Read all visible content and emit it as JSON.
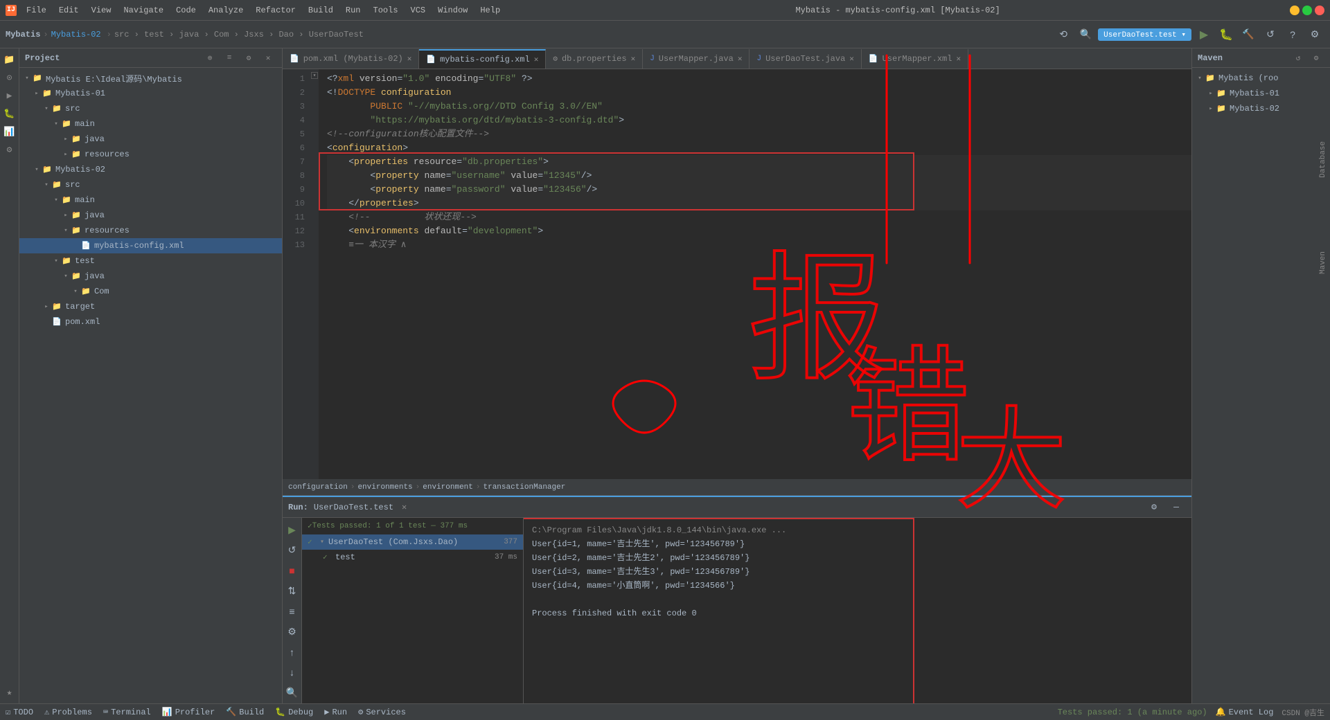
{
  "titlebar": {
    "title": "Mybatis - mybatis-config.xml [Mybatis-02]",
    "logo": "IJ",
    "menus": [
      "File",
      "Edit",
      "View",
      "Navigate",
      "Code",
      "Analyze",
      "Refactor",
      "Build",
      "Run",
      "Tools",
      "VCS",
      "Window",
      "Help"
    ]
  },
  "breadcrumb": {
    "items": [
      "Mybatis",
      "Mybatis-02",
      "src",
      "test",
      "java",
      "Com",
      "Jsxs",
      "Dao",
      "UserDaoTest"
    ]
  },
  "tabs": [
    {
      "label": "pom.xml (Mybatis-02)",
      "active": false,
      "icon": "pom"
    },
    {
      "label": "mybatis-config.xml",
      "active": true,
      "icon": "xml"
    },
    {
      "label": "db.properties",
      "active": false,
      "icon": "props"
    },
    {
      "label": "UserMapper.java",
      "active": false,
      "icon": "java"
    },
    {
      "label": "UserDaoTest.java",
      "active": false,
      "icon": "java"
    },
    {
      "label": "UserMapper.xml",
      "active": false,
      "icon": "xml"
    }
  ],
  "code": {
    "lines": [
      {
        "num": 1,
        "text": "<?xml version=\"1.0\" encoding=\"UTF8\" ?>"
      },
      {
        "num": 2,
        "text": "<!DOCTYPE configuration"
      },
      {
        "num": 3,
        "text": "        PUBLIC \"-//mybatis.org//DTD Config 3.0//EN\""
      },
      {
        "num": 4,
        "text": "        \"https://mybatis.org/dtd/mybatis-3-config.dtd\">"
      },
      {
        "num": 5,
        "text": "<!--configuration核心配置文件-->"
      },
      {
        "num": 6,
        "text": "<configuration>"
      },
      {
        "num": 7,
        "text": "    <properties resource=\"db.properties\">"
      },
      {
        "num": 8,
        "text": "        <property name=\"username\" value=\"12345\"/>"
      },
      {
        "num": 9,
        "text": "        <property name=\"password\" value=\"123456\"/>"
      },
      {
        "num": 10,
        "text": "    </properties>"
      },
      {
        "num": 11,
        "text": "    <!--          状状还现-->"
      },
      {
        "num": 12,
        "text": "    <environments default=\"development\">"
      },
      {
        "num": 13,
        "text": "    <)"
      }
    ]
  },
  "nav_breadcrumb": {
    "items": [
      "configuration",
      "environments",
      "environment",
      "transactionManager"
    ]
  },
  "project": {
    "title": "Project",
    "tree": [
      {
        "id": "mybatis-root",
        "label": "Mybatis E:\\Ideal源码\\Mybatis",
        "level": 0,
        "expanded": true,
        "icon": "folder"
      },
      {
        "id": "mybatis-01",
        "label": "Mybatis-01",
        "level": 1,
        "expanded": true,
        "icon": "folder"
      },
      {
        "id": "src-01",
        "label": "src",
        "level": 2,
        "expanded": true,
        "icon": "folder"
      },
      {
        "id": "main-01",
        "label": "main",
        "level": 3,
        "expanded": true,
        "icon": "folder"
      },
      {
        "id": "java-01",
        "label": "java",
        "level": 4,
        "expanded": false,
        "icon": "folder"
      },
      {
        "id": "resources-01",
        "label": "resources",
        "level": 4,
        "expanded": false,
        "icon": "folder"
      },
      {
        "id": "mybatis-02",
        "label": "Mybatis-02",
        "level": 1,
        "expanded": true,
        "icon": "folder"
      },
      {
        "id": "src-02",
        "label": "src",
        "level": 2,
        "expanded": true,
        "icon": "folder"
      },
      {
        "id": "main-02",
        "label": "main",
        "level": 3,
        "expanded": true,
        "icon": "folder"
      },
      {
        "id": "java-02",
        "label": "java",
        "level": 4,
        "expanded": true,
        "icon": "folder"
      },
      {
        "id": "resources-02",
        "label": "resources",
        "level": 4,
        "expanded": true,
        "icon": "folder"
      },
      {
        "id": "mybatis-config",
        "label": "mybatis-config.xml",
        "level": 5,
        "expanded": false,
        "icon": "xml",
        "selected": true
      },
      {
        "id": "test-02",
        "label": "test",
        "level": 3,
        "expanded": true,
        "icon": "folder"
      },
      {
        "id": "java-test",
        "label": "java",
        "level": 4,
        "expanded": true,
        "icon": "folder"
      },
      {
        "id": "com",
        "label": "Com",
        "level": 5,
        "expanded": true,
        "icon": "folder"
      },
      {
        "id": "target",
        "label": "target",
        "level": 2,
        "expanded": false,
        "icon": "folder"
      },
      {
        "id": "pom",
        "label": "pom.xml",
        "level": 2,
        "expanded": false,
        "icon": "xml"
      }
    ]
  },
  "maven": {
    "title": "Maven",
    "items": [
      {
        "label": "Mybatis (root)",
        "level": 0,
        "expanded": true
      },
      {
        "label": "Mybatis-01",
        "level": 1,
        "expanded": false
      },
      {
        "label": "Mybatis-02",
        "level": 1,
        "expanded": false
      }
    ]
  },
  "run": {
    "label": "Run:",
    "tab_name": "UserDaoTest.test",
    "tests_header": "Tests passed: 1 of 1 test — 377 ms",
    "test_suite": "UserDaoTest (Com.Jsxs.Dao)",
    "test_suite_time": "377",
    "test_case": "test",
    "test_case_time": "37 ms",
    "output_lines": [
      "C:\\Program Files\\Java\\jdk1.8.0_144\\bin\\java.exe ...",
      "User{id=1, mame='吉士先生', pwd='123456789'}",
      "User{id=2, mame='吉士先生2', pwd='123456789'}",
      "User{id=3, mame='吉士先生3', pwd='123456789'}",
      "User{id=4, mame='小直筒啊', pwd='1234566'}",
      "",
      "Process finished with exit code 0"
    ]
  },
  "statusbar": {
    "todo": "TODO",
    "problems": "Problems",
    "terminal": "Terminal",
    "profiler": "Profiler",
    "build": "Build",
    "debug": "Debug",
    "run": "Run",
    "services": "Services",
    "event_log": "Event Log",
    "status_text": "Tests passed: 1 (a minute ago)",
    "user": "CSDN @吉生"
  }
}
